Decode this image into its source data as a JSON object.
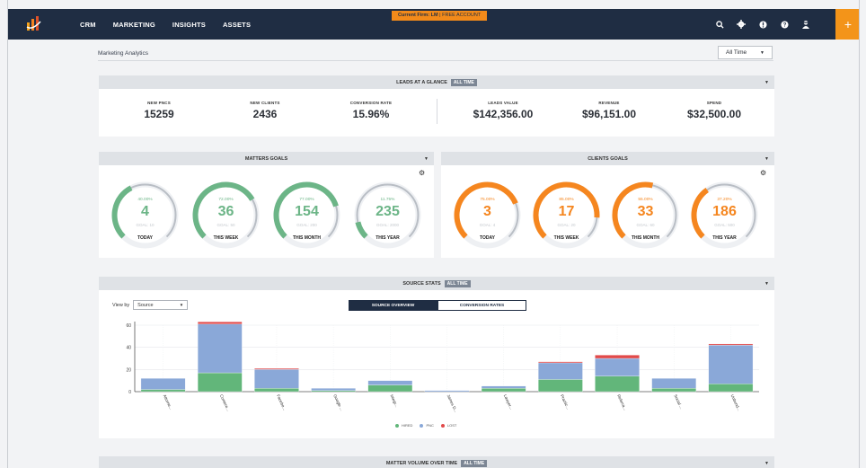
{
  "nav": {
    "items": [
      "CRM",
      "MARKETING",
      "INSIGHTS",
      "ASSETS"
    ]
  },
  "firm_banner": {
    "prefix": "Current Firm: LM",
    "suffix": " | FREE ACCOUNT"
  },
  "header_icons": [
    "search-icon",
    "gear-icon",
    "alert-icon",
    "help-icon",
    "user-icon"
  ],
  "plus_label": "+",
  "page": {
    "title": "Marketing Analytics",
    "range": "All Time"
  },
  "leads": {
    "title": "LEADS AT A GLANCE",
    "badge": "ALL TIME",
    "stats": [
      {
        "label": "NEW PNCS",
        "value": "15259"
      },
      {
        "label": "NEW CLIENTS",
        "value": "2436"
      },
      {
        "label": "CONVERSION RATE",
        "value": "15.96%"
      },
      {
        "label": "LEADS VALUE",
        "value": "$142,356.00"
      },
      {
        "label": "REVENUE",
        "value": "$96,151.00"
      },
      {
        "label": "SPEND",
        "value": "$32,500.00"
      }
    ]
  },
  "matters_goals": {
    "title": "MATTERS GOALS",
    "color": "#6cb587",
    "gauges": [
      {
        "pct": "40.00%",
        "value": "4",
        "goal": "GOAL: 10",
        "label": "TODAY",
        "fraction": 0.4
      },
      {
        "pct": "72.00%",
        "value": "36",
        "goal": "GOAL: 50",
        "label": "THIS WEEK",
        "fraction": 0.72
      },
      {
        "pct": "77.00%",
        "value": "154",
        "goal": "GOAL: 200",
        "label": "THIS MONTH",
        "fraction": 0.77
      },
      {
        "pct": "11.75%",
        "value": "235",
        "goal": "GOAL: 2000",
        "label": "THIS YEAR",
        "fraction": 0.1175
      }
    ]
  },
  "clients_goals": {
    "title": "CLIENTS GOALS",
    "color": "#f5861f",
    "gauges": [
      {
        "pct": "75.00%",
        "value": "3",
        "goal": "GOAL: 4",
        "label": "TODAY",
        "fraction": 0.75
      },
      {
        "pct": "85.00%",
        "value": "17",
        "goal": "GOAL: 20",
        "label": "THIS WEEK",
        "fraction": 0.85
      },
      {
        "pct": "55.00%",
        "value": "33",
        "goal": "GOAL: 60",
        "label": "THIS MONTH",
        "fraction": 0.55
      },
      {
        "pct": "37.20%",
        "value": "186",
        "goal": "GOAL: 500",
        "label": "THIS YEAR",
        "fraction": 0.372
      }
    ]
  },
  "source_stats": {
    "title": "SOURCE STATS",
    "badge": "ALL TIME",
    "view_by_label": "View by",
    "view_by_value": "Source",
    "tabs": [
      "SOURCE OVERVIEW",
      "CONVERSION RATES"
    ],
    "legend": [
      "HIRED",
      "PNC",
      "LOST"
    ]
  },
  "chart_data": {
    "type": "bar",
    "stacked": true,
    "ylim": [
      0,
      60
    ],
    "yticks": [
      0,
      20,
      40,
      60
    ],
    "categories": [
      "Attorne...",
      "Contere...",
      "Facebo...",
      "Google ...",
      "Integr...",
      "James D...",
      "Lawyer...",
      "Practic...",
      "Referra...",
      "Social ...",
      "Unbund..."
    ],
    "series": [
      {
        "name": "HIRED",
        "color": "#62b67a",
        "values": [
          2,
          17,
          3,
          1,
          6,
          0,
          3,
          11,
          14,
          3,
          7
        ]
      },
      {
        "name": "PNC",
        "color": "#8aa8d8",
        "values": [
          10,
          44,
          17,
          2,
          4,
          1,
          2,
          15,
          16,
          9,
          35
        ]
      },
      {
        "name": "LOST",
        "color": "#e14a4a",
        "values": [
          0,
          2,
          1,
          0,
          0,
          0,
          0,
          1,
          3,
          0,
          1
        ]
      }
    ]
  },
  "matter_volume": {
    "title": "MATTER VOLUME OVER TIME",
    "badge": "ALL TIME"
  }
}
